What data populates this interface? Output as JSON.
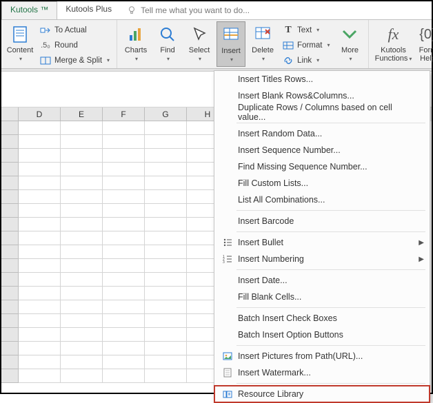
{
  "tabs": {
    "kutools": "Kutools ™",
    "plus": "Kutools Plus"
  },
  "tellme": "Tell me what you want to do...",
  "ribbon": {
    "content": "Content",
    "toactual": "To Actual",
    "round": "Round",
    "merge": "Merge & Split",
    "charts": "Charts",
    "find": "Find",
    "select": "Select",
    "insert": "Insert",
    "delete": "Delete",
    "text": "Text",
    "format": "Format",
    "link": "Link",
    "more": "More",
    "functions_line1": "Kutools",
    "functions_line2": "Functions",
    "formhelp_line1": "Form",
    "formhelp_line2": "Help"
  },
  "cols": [
    "D",
    "E",
    "F",
    "G",
    "H"
  ],
  "menu": {
    "titles": "Insert Titles Rows...",
    "blank": "Insert Blank Rows&Columns...",
    "dup": "Duplicate Rows / Columns based on cell value...",
    "random": "Insert Random Data...",
    "seq": "Insert Sequence Number...",
    "findseq": "Find Missing Sequence Number...",
    "fill": "Fill Custom Lists...",
    "combos": "List All Combinations...",
    "barcode": "Insert Barcode",
    "bullet": "Insert Bullet",
    "numbering": "Insert Numbering",
    "date": "Insert Date...",
    "blankcells": "Fill Blank Cells...",
    "checkbox": "Batch Insert Check Boxes",
    "option": "Batch Insert Option Buttons",
    "pics": "Insert Pictures from Path(URL)...",
    "watermark": "Insert Watermark...",
    "resource": "Resource Library"
  }
}
